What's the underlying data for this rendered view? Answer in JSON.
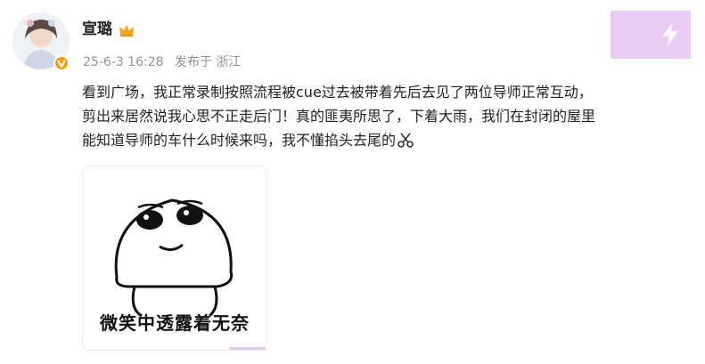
{
  "post": {
    "author": {
      "name": "宣璐",
      "icons": [
        "avatar-photo",
        "verified-badge-icon",
        "crown-icon"
      ]
    },
    "meta": {
      "date": "25-6-3 16:28",
      "source": "发布于 浙江"
    },
    "content_lines": [
      "看到广场，我正常录制按照流程被cue过去被带着先后去见了两位导师正常互动，",
      "剪出来居然说我心思不正走后门！真的匪夷所思了，下着大雨，我们在封闭的屋里",
      "能知道导师的车什么时候来吗，我不懂掐头去尾的"
    ],
    "content_emoji": "scissors-icon",
    "image": {
      "caption": "微笑中透露着无奈",
      "icon": "meme-smiling-face"
    }
  },
  "colors": {
    "text": "#222222",
    "meta": "#939393",
    "badge": "#f39c12",
    "accent_overlay": "#e9ccf4"
  }
}
